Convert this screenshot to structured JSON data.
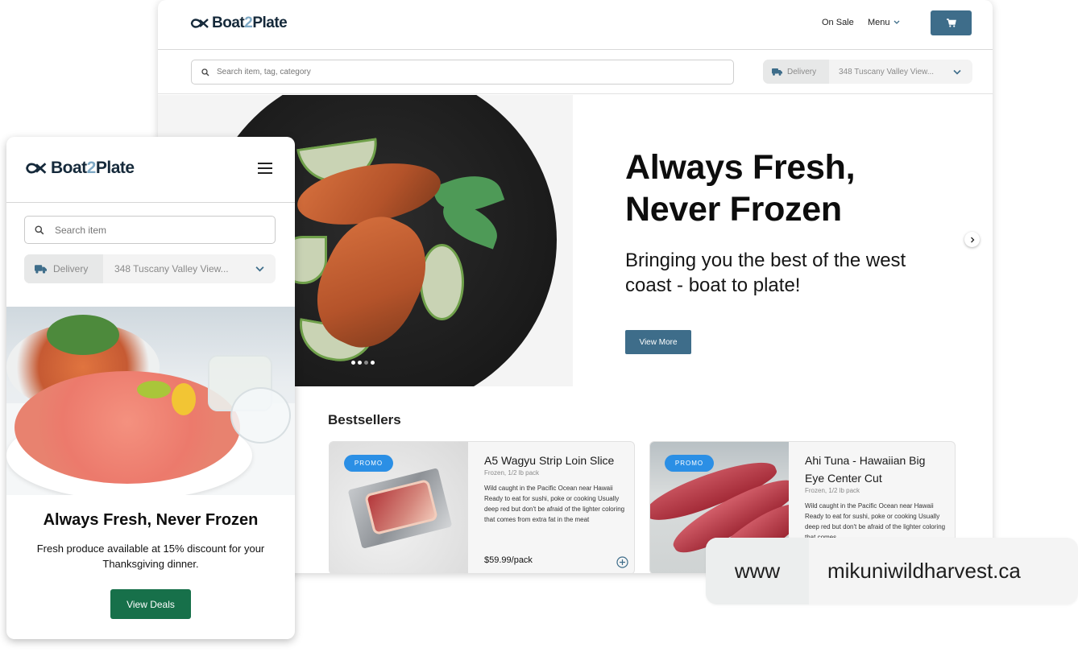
{
  "brand": {
    "name_part1": "Boat",
    "name_part2": "2",
    "name_part3": "Plate",
    "primary_color": "#3e6d8a",
    "accent_green": "#17704a",
    "promo_blue": "#2b8fe5"
  },
  "desktop": {
    "nav": {
      "on_sale": "On Sale",
      "menu": "Menu"
    },
    "search": {
      "placeholder": "Search item, tag, category"
    },
    "delivery": {
      "label": "Delivery",
      "address": "348 Tuscany Valley View..."
    },
    "hero": {
      "title": "Always Fresh, Never Frozen",
      "subtitle": "Bringing you the best of the west coast - boat to plate!",
      "cta": "View More",
      "carousel": {
        "slides": 4,
        "active": 3
      }
    },
    "bestsellers": {
      "heading": "Bestsellers",
      "items": [
        {
          "badge": "PROMO",
          "name": "A5 Wagyu Strip Loin Slice",
          "meta": "Frozen, 1/2 lb pack",
          "description": "Wild caught in the Pacific Ocean near Hawaii Ready to eat for sushi, poke or cooking Usually deep red but don't be afraid of the lighter coloring that comes from extra fat in the meat",
          "price": "$59.99/pack"
        },
        {
          "badge": "PROMO",
          "name": "Ahi Tuna - Hawaiian Big Eye Center Cut",
          "meta": "Frozen, 1/2 lb pack",
          "description": "Wild caught in the Pacific Ocean near Hawaii Ready to eat for sushi, poke or cooking Usually deep red but don't be afraid of the lighter coloring that comes"
        }
      ]
    }
  },
  "mobile": {
    "search": {
      "placeholder": "Search item"
    },
    "delivery": {
      "label": "Delivery",
      "address": "348 Tuscany Valley View..."
    },
    "promo": {
      "title": "Always Fresh, Never Frozen",
      "subtitle": "Fresh produce available at 15% discount for your Thanksgiving dinner.",
      "cta": "View Deals"
    }
  },
  "url": {
    "prefix": "www",
    "domain": "mikuniwildharvest.ca"
  }
}
